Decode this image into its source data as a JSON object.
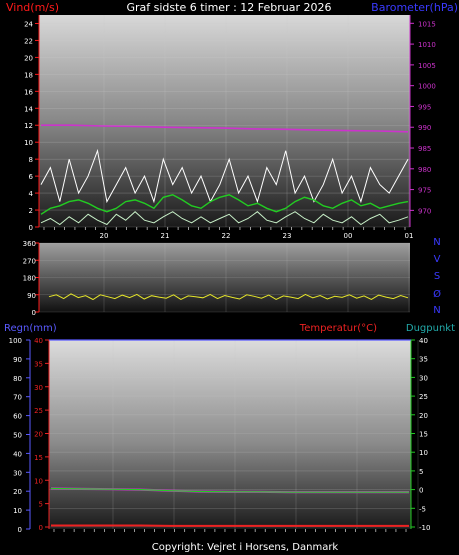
{
  "title": "Graf sidste 6 timer : 12 Februar 2026",
  "footer": "Copyright: Vejret i Horsens, Danmark",
  "panel1": {
    "left_label": "Vind(m/s)",
    "right_label": "Barometer(hPa)",
    "x_ticks": [
      "20",
      "21",
      "22",
      "23",
      "00",
      "01"
    ]
  },
  "panel2": {
    "y_ticks": [
      "360",
      "270",
      "180",
      "90",
      "0"
    ],
    "compass": [
      "N",
      "V",
      "S",
      "Ø",
      "N"
    ]
  },
  "panel3": {
    "rain_label": "Regn(mm)",
    "temp_label": "Temperatur(°C)",
    "dew_label": "Dugpunkt"
  },
  "colors": {
    "wind_label": "#ff1a1a",
    "barometer_label": "#3a3aff",
    "gust": "#ffffff",
    "avg_wind": "#22cc22",
    "min_wind": "#c8f0c8",
    "pressure": "#cc33cc",
    "direction": "#e6e62a",
    "rain_axis": "#5a5aff",
    "temp": "#ee2222",
    "dewpoint": "#22cc22",
    "dew_label": "#22aaaa"
  },
  "chart_data": [
    {
      "type": "line",
      "title": "Graf sidste 6 timer : 12 Februar 2026",
      "xlabel": "",
      "ylabel": "Vind(m/s)",
      "y2label": "Barometer(hPa)",
      "x_categories": [
        "20",
        "21",
        "22",
        "23",
        "00",
        "01"
      ],
      "ylim": [
        0,
        25
      ],
      "y_ticks": [
        0,
        2,
        4,
        6,
        8,
        10,
        12,
        14,
        16,
        18,
        20,
        22,
        24
      ],
      "y2lim": [
        966,
        1017
      ],
      "y2_ticks": [
        970,
        975,
        980,
        985,
        990,
        995,
        1000,
        1005,
        1010,
        1015
      ],
      "series": [
        {
          "axis": "left",
          "values": [
            5,
            7,
            3,
            8,
            4,
            6,
            9,
            3,
            5,
            7,
            4,
            6,
            3,
            8,
            5,
            7,
            4,
            6,
            3,
            5,
            8,
            4,
            6,
            3,
            7,
            5,
            9,
            4,
            6,
            3,
            5,
            8,
            4,
            6,
            3,
            7,
            5,
            4,
            6,
            8
          ]
        },
        {
          "axis": "left",
          "values": [
            1.5,
            2.2,
            2.5,
            3,
            3.2,
            2.8,
            2.2,
            1.8,
            2.2,
            3,
            3.2,
            2.8,
            2.2,
            3.5,
            3.8,
            3.2,
            2.5,
            2.2,
            3,
            3.5,
            3.8,
            3.2,
            2.5,
            2.8,
            2.2,
            1.8,
            2.2,
            3,
            3.5,
            3.2,
            2.5,
            2.2,
            2.8,
            3.2,
            2.5,
            2.8,
            2.2,
            2.5,
            2.8,
            3
          ]
        },
        {
          "axis": "left",
          "values": [
            0.5,
            1,
            0.3,
            1.2,
            0.5,
            1.5,
            0.8,
            0.3,
            1.5,
            0.8,
            1.8,
            0.8,
            0.5,
            1.2,
            1.8,
            1,
            0.5,
            1.2,
            0.5,
            1,
            1.5,
            0.5,
            1,
            1.8,
            0.8,
            0.5,
            1.2,
            1.8,
            1,
            0.5,
            1.5,
            0.8,
            0.5,
            1.2,
            0.3,
            1,
            1.5,
            0.5,
            0.8,
            1.2
          ]
        },
        {
          "axis": "right",
          "values": [
            990.5,
            990.5,
            990.3,
            990.2,
            990.0,
            989.9,
            989.8,
            989.6,
            989.5,
            989.3,
            989.2,
            989.1,
            988.9
          ]
        }
      ]
    },
    {
      "type": "line",
      "ylabel": "",
      "ylim": [
        0,
        360
      ],
      "y_ticks": [
        0,
        90,
        180,
        270,
        360
      ],
      "series": [
        {
          "values": [
            80,
            90,
            70,
            95,
            75,
            85,
            65,
            90,
            80,
            70,
            88,
            75,
            92,
            68,
            85,
            78,
            72,
            90,
            66,
            84,
            80,
            74,
            92,
            70,
            86,
            76,
            68,
            90,
            82,
            72,
            88,
            66,
            84,
            78,
            70,
            92,
            74,
            86,
            68,
            82,
            76,
            90,
            72,
            84,
            66,
            88,
            78,
            70,
            86,
            74
          ]
        }
      ]
    },
    {
      "type": "line",
      "ylabel": "Regn(mm)",
      "ylim": [
        0,
        100
      ],
      "y_ticks": [
        0,
        10,
        20,
        30,
        40,
        50,
        60,
        70,
        80,
        90,
        100
      ],
      "y_mid_ticks": [
        0,
        5,
        10,
        15,
        20,
        25,
        30,
        35,
        40
      ],
      "y2label": "Temperatur(°C)",
      "y2lim": [
        -10,
        40
      ],
      "y2_ticks": [
        -10,
        -5,
        0,
        5,
        10,
        15,
        20,
        25,
        30,
        35,
        40
      ],
      "series": [
        {
          "name": "Temperatur(°C)",
          "axis": "right",
          "values": [
            -9.6,
            -9.6,
            -9.6,
            -9.6,
            -9.7,
            -9.7,
            -9.7,
            -9.7,
            -9.7,
            -9.7,
            -9.7,
            -9.7,
            -9.7
          ]
        },
        {
          "name": "Dugpunkt",
          "axis": "right",
          "values": [
            0.3,
            0.2,
            0.1,
            0.0,
            -0.3,
            -0.5,
            -0.6,
            -0.6,
            -0.7,
            -0.7,
            -0.7,
            -0.7,
            -0.7
          ]
        }
      ]
    }
  ]
}
